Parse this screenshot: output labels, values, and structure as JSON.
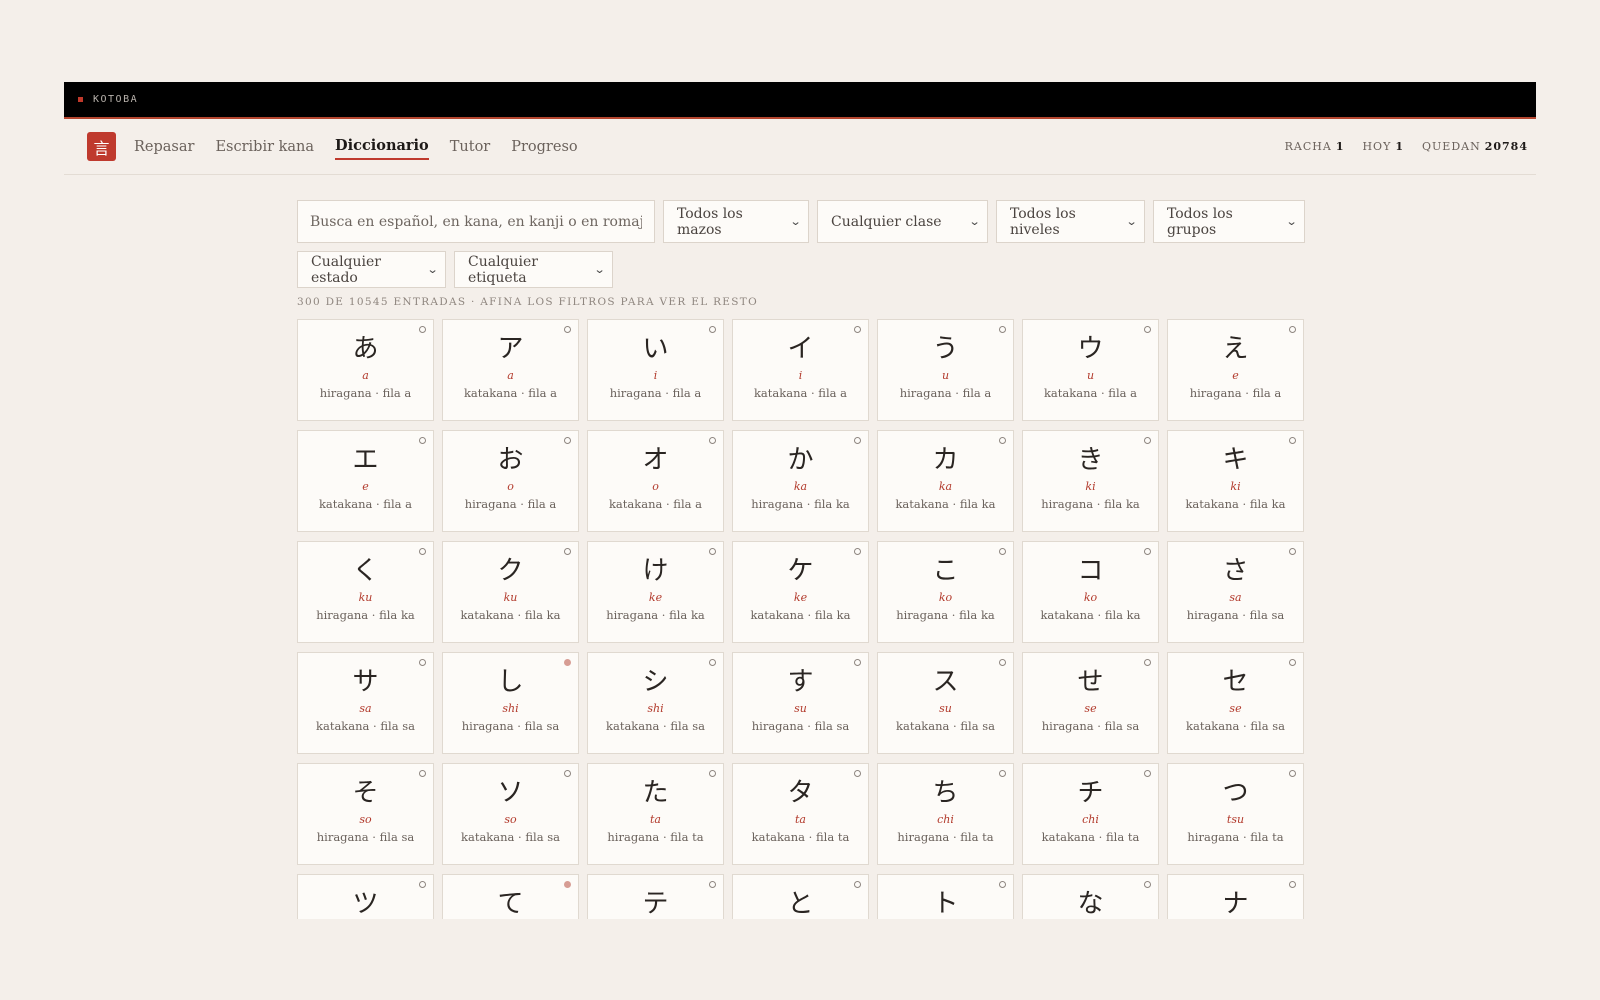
{
  "app": {
    "name": "KOTOBA",
    "logo_glyph": "言",
    "accent": "#bf3a2e"
  },
  "nav": {
    "items": [
      {
        "label": "Repasar",
        "active": false
      },
      {
        "label": "Escribir kana",
        "active": false
      },
      {
        "label": "Diccionario",
        "active": true
      },
      {
        "label": "Tutor",
        "active": false
      },
      {
        "label": "Progreso",
        "active": false
      }
    ]
  },
  "stats": {
    "racha_label": "RACHA",
    "racha_value": "1",
    "hoy_label": "HOY",
    "hoy_value": "1",
    "quedan_label": "QUEDAN",
    "quedan_value": "20784"
  },
  "filters": {
    "search_placeholder": "Busca en español, en kana, en kanji o en romaji...",
    "mazos": "Todos los mazos",
    "clase": "Cualquier clase",
    "niveles": "Todos los niveles",
    "grupos": "Todos los grupos",
    "estado": "Cualquier estado",
    "etiqueta": "Cualquier etiqueta"
  },
  "count_text": "300 DE 10545 ENTRADAS · AFINA LOS FILTROS PARA VER EL RESTO",
  "cards": [
    {
      "kana": "あ",
      "romaji": "a",
      "meta": "hiragana · fila a",
      "status": "empty"
    },
    {
      "kana": "ア",
      "romaji": "a",
      "meta": "katakana · fila a",
      "status": "empty"
    },
    {
      "kana": "い",
      "romaji": "i",
      "meta": "hiragana · fila a",
      "status": "empty"
    },
    {
      "kana": "イ",
      "romaji": "i",
      "meta": "katakana · fila a",
      "status": "empty"
    },
    {
      "kana": "う",
      "romaji": "u",
      "meta": "hiragana · fila a",
      "status": "empty"
    },
    {
      "kana": "ウ",
      "romaji": "u",
      "meta": "katakana · fila a",
      "status": "empty"
    },
    {
      "kana": "え",
      "romaji": "e",
      "meta": "hiragana · fila a",
      "status": "empty"
    },
    {
      "kana": "エ",
      "romaji": "e",
      "meta": "katakana · fila a",
      "status": "empty"
    },
    {
      "kana": "お",
      "romaji": "o",
      "meta": "hiragana · fila a",
      "status": "empty"
    },
    {
      "kana": "オ",
      "romaji": "o",
      "meta": "katakana · fila a",
      "status": "empty"
    },
    {
      "kana": "か",
      "romaji": "ka",
      "meta": "hiragana · fila ka",
      "status": "empty"
    },
    {
      "kana": "カ",
      "romaji": "ka",
      "meta": "katakana · fila ka",
      "status": "empty"
    },
    {
      "kana": "き",
      "romaji": "ki",
      "meta": "hiragana · fila ka",
      "status": "empty"
    },
    {
      "kana": "キ",
      "romaji": "ki",
      "meta": "katakana · fila ka",
      "status": "empty"
    },
    {
      "kana": "く",
      "romaji": "ku",
      "meta": "hiragana · fila ka",
      "status": "empty"
    },
    {
      "kana": "ク",
      "romaji": "ku",
      "meta": "katakana · fila ka",
      "status": "empty"
    },
    {
      "kana": "け",
      "romaji": "ke",
      "meta": "hiragana · fila ka",
      "status": "empty"
    },
    {
      "kana": "ケ",
      "romaji": "ke",
      "meta": "katakana · fila ka",
      "status": "empty"
    },
    {
      "kana": "こ",
      "romaji": "ko",
      "meta": "hiragana · fila ka",
      "status": "empty"
    },
    {
      "kana": "コ",
      "romaji": "ko",
      "meta": "katakana · fila ka",
      "status": "empty"
    },
    {
      "kana": "さ",
      "romaji": "sa",
      "meta": "hiragana · fila sa",
      "status": "empty"
    },
    {
      "kana": "サ",
      "romaji": "sa",
      "meta": "katakana · fila sa",
      "status": "empty"
    },
    {
      "kana": "し",
      "romaji": "shi",
      "meta": "hiragana · fila sa",
      "status": "filled"
    },
    {
      "kana": "シ",
      "romaji": "shi",
      "meta": "katakana · fila sa",
      "status": "empty"
    },
    {
      "kana": "す",
      "romaji": "su",
      "meta": "hiragana · fila sa",
      "status": "empty"
    },
    {
      "kana": "ス",
      "romaji": "su",
      "meta": "katakana · fila sa",
      "status": "empty"
    },
    {
      "kana": "せ",
      "romaji": "se",
      "meta": "hiragana · fila sa",
      "status": "empty"
    },
    {
      "kana": "セ",
      "romaji": "se",
      "meta": "katakana · fila sa",
      "status": "empty"
    },
    {
      "kana": "そ",
      "romaji": "so",
      "meta": "hiragana · fila sa",
      "status": "empty"
    },
    {
      "kana": "ソ",
      "romaji": "so",
      "meta": "katakana · fila sa",
      "status": "empty"
    },
    {
      "kana": "た",
      "romaji": "ta",
      "meta": "hiragana · fila ta",
      "status": "empty"
    },
    {
      "kana": "タ",
      "romaji": "ta",
      "meta": "katakana · fila ta",
      "status": "empty"
    },
    {
      "kana": "ち",
      "romaji": "chi",
      "meta": "hiragana · fila ta",
      "status": "empty"
    },
    {
      "kana": "チ",
      "romaji": "chi",
      "meta": "katakana · fila ta",
      "status": "empty"
    },
    {
      "kana": "つ",
      "romaji": "tsu",
      "meta": "hiragana · fila ta",
      "status": "empty"
    },
    {
      "kana": "ツ",
      "romaji": "",
      "meta": "",
      "status": "empty"
    },
    {
      "kana": "て",
      "romaji": "",
      "meta": "",
      "status": "filled"
    },
    {
      "kana": "テ",
      "romaji": "",
      "meta": "",
      "status": "empty"
    },
    {
      "kana": "と",
      "romaji": "",
      "meta": "",
      "status": "empty"
    },
    {
      "kana": "ト",
      "romaji": "",
      "meta": "",
      "status": "empty"
    },
    {
      "kana": "な",
      "romaji": "",
      "meta": "",
      "status": "empty"
    },
    {
      "kana": "ナ",
      "romaji": "",
      "meta": "",
      "status": "empty"
    }
  ]
}
